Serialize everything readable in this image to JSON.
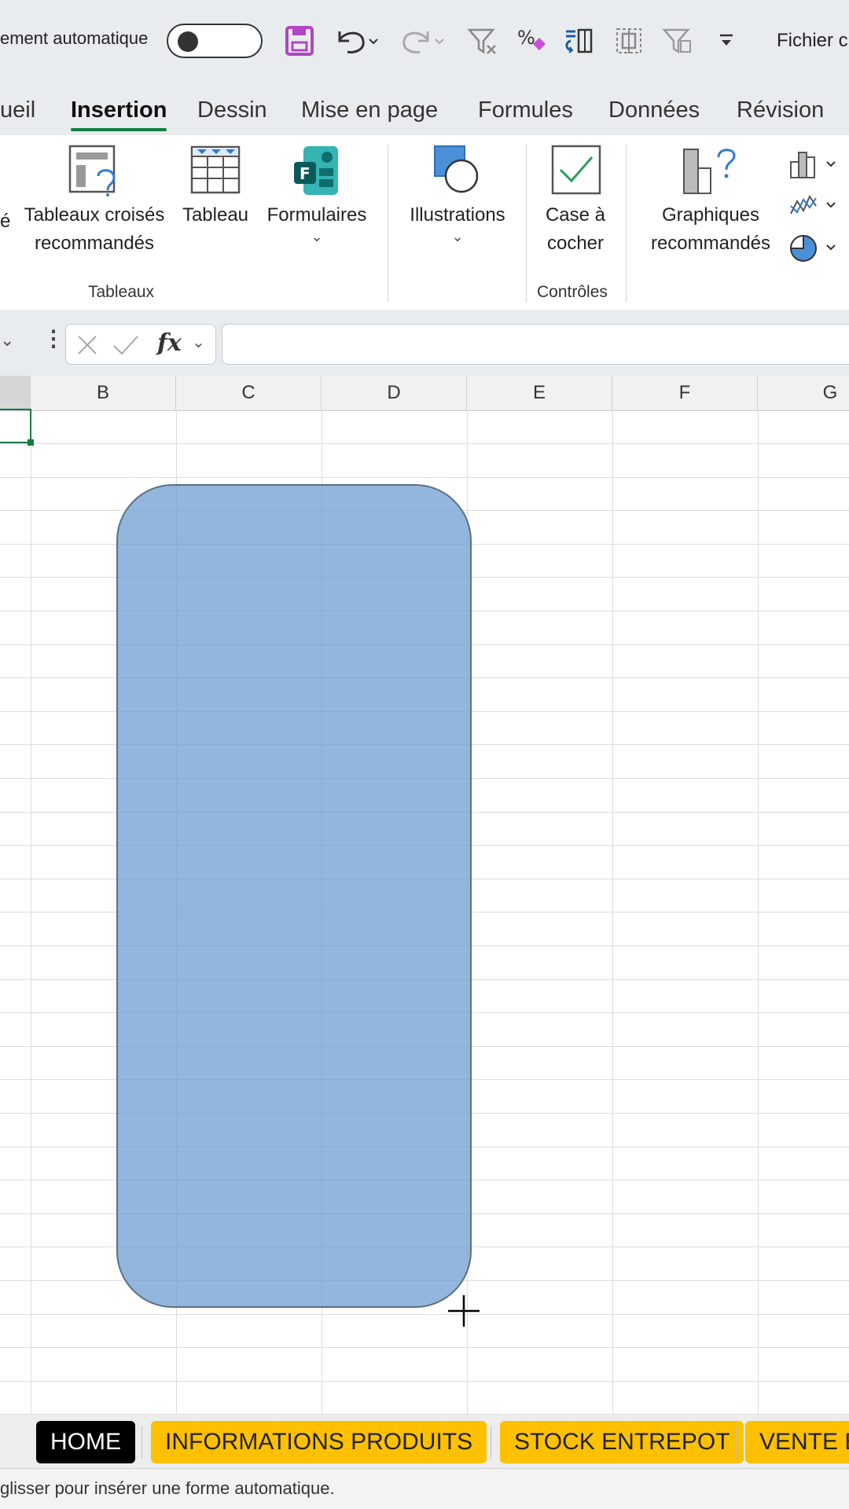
{
  "qat": {
    "autosave_label": "ement automatique",
    "file_label": "Fichier c"
  },
  "tabs": [
    "ueil",
    "Insertion",
    "Dessin",
    "Mise en page",
    "Formules",
    "Données",
    "Révision"
  ],
  "active_tab": "Insertion",
  "ribbon": {
    "partial_left": "é",
    "pivot_recommended": [
      "Tableaux croisés",
      "recommandés"
    ],
    "table": "Tableau",
    "forms": "Formulaires",
    "illustrations": "Illustrations",
    "checkbox": [
      "Case à",
      "cocher"
    ],
    "recommended_charts": [
      "Graphiques",
      "recommandés"
    ],
    "group_tables": "Tableaux",
    "group_controls": "Contrôles"
  },
  "formula_bar": {
    "fx_label": "fx",
    "value": ""
  },
  "columns": [
    "B",
    "C",
    "D",
    "E",
    "F",
    "G"
  ],
  "sheet_tabs": [
    "HOME",
    "INFORMATIONS PRODUITS",
    "STOCK ENTREPOT",
    "VENTE B"
  ],
  "active_sheet": "HOME",
  "status_text": "glisser pour insérer une forme automatique.",
  "colors": {
    "accent": "#107c41",
    "sheet_tab_yellow": "#ffc000",
    "shape_fill": "#8ab4dc"
  }
}
